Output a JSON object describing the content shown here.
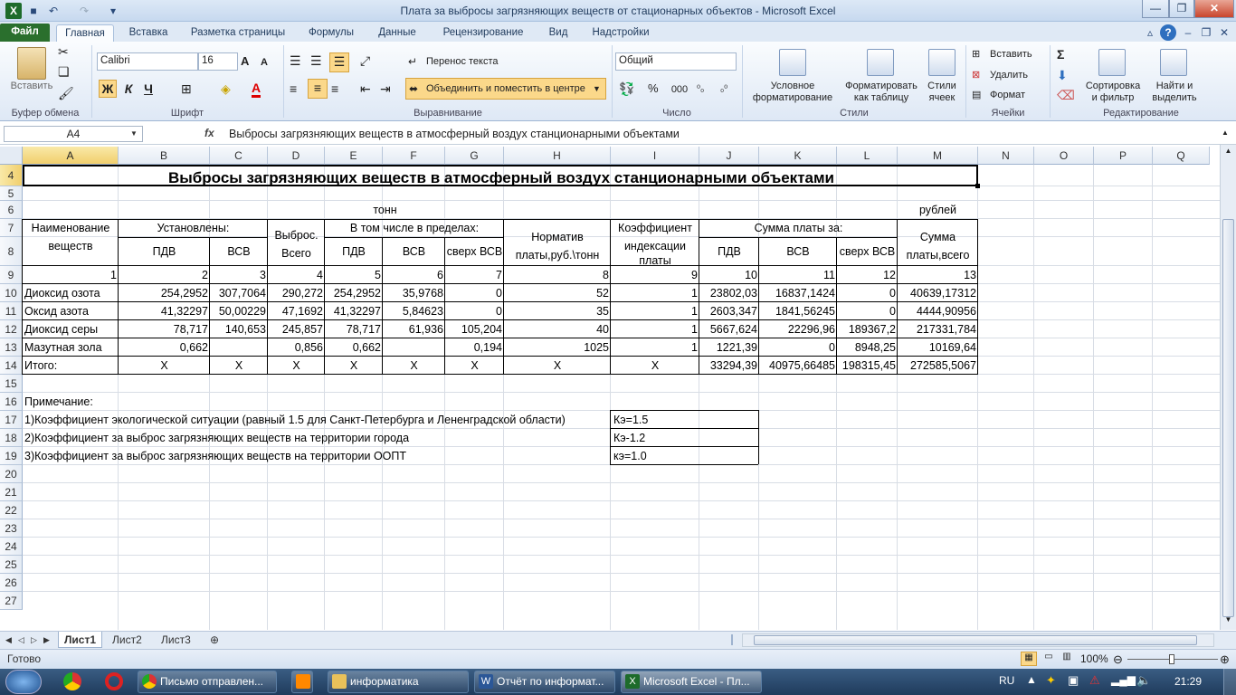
{
  "window": {
    "title": "Плата за выбросы загрязняющих веществ от  стационарных объектов  -  Microsoft Excel"
  },
  "ribbon_tabs": [
    "Файл",
    "Главная",
    "Вставка",
    "Разметка страницы",
    "Формулы",
    "Данные",
    "Рецензирование",
    "Вид",
    "Надстройки"
  ],
  "clipboard": {
    "paste": "Вставить",
    "group": "Буфер обмена"
  },
  "font": {
    "name": "Calibri",
    "size": "16",
    "group": "Шрифт",
    "bold": "Ж",
    "italic": "К",
    "underline": "Ч"
  },
  "alignment": {
    "wrap": "Перенос текста",
    "merge": "Объединить и поместить в центре",
    "group": "Выравнивание"
  },
  "number": {
    "format": "Общий",
    "group": "Число",
    "percent": "%",
    "thousands": "000"
  },
  "styles": {
    "cond1": "Условное",
    "cond2": "форматирование",
    "table1": "Форматировать",
    "table2": "как таблицу",
    "cell1": "Стили",
    "cell2": "ячеек",
    "group": "Стили"
  },
  "cells_grp": {
    "insert": "Вставить",
    "delete": "Удалить",
    "format": "Формат",
    "group": "Ячейки"
  },
  "editing": {
    "sort1": "Сортировка",
    "sort2": "и фильтр",
    "find1": "Найти и",
    "find2": "выделить",
    "group": "Редактирование"
  },
  "formula_bar": {
    "name_box": "A4",
    "fx": "fx",
    "content": "Выбросы загрязняющих веществ в атмосферный воздух станционарными объектами"
  },
  "columns": [
    "A",
    "B",
    "C",
    "D",
    "E",
    "F",
    "G",
    "H",
    "I",
    "J",
    "K",
    "L",
    "M",
    "N",
    "O",
    "P",
    "Q"
  ],
  "rows": [
    "4",
    "5",
    "6",
    "7",
    "8",
    "9",
    "10",
    "11",
    "12",
    "13",
    "14",
    "15",
    "16",
    "17",
    "18",
    "19",
    "20",
    "21",
    "22",
    "23",
    "24",
    "25",
    "26",
    "27"
  ],
  "sheet": {
    "title": "Выбросы загрязняющих веществ в атмосферный воздух станционарными объектами",
    "unit_tons": "тонн",
    "unit_rub": "рублей",
    "h_name1": "Наименование",
    "h_name2": "веществ",
    "h_established": "Установлены:",
    "h_pdv": "ПДВ",
    "h_vsv": "ВСВ",
    "h_emission1": "Выброс.",
    "h_emission2": "Всего",
    "h_within": "В том числе в пределах:",
    "h_over": "сверх ВСВ",
    "h_norm1": "Норматив",
    "h_norm2": "платы,руб.\\тонн",
    "h_coef1": "Коэффициент",
    "h_coef2": "индексации",
    "h_coef3": "платы",
    "h_sum": "Сумма платы за:",
    "h_total1": "Сумма",
    "h_total2": "платы,всего",
    "numbers": [
      "1",
      "2",
      "3",
      "4",
      "5",
      "6",
      "7",
      "8",
      "9",
      "10",
      "11",
      "12",
      "13"
    ],
    "data_rows": [
      [
        "Диоксид озота",
        "254,2952",
        "307,7064",
        "290,272",
        "254,2952",
        "35,9768",
        "0",
        "52",
        "1",
        "23802,03",
        "16837,1424",
        "0",
        "40639,17312"
      ],
      [
        "Оксид азота",
        "41,32297",
        "50,00229",
        "47,1692",
        "41,32297",
        "5,84623",
        "0",
        "35",
        "1",
        "2603,347",
        "1841,56245",
        "0",
        "4444,90956"
      ],
      [
        "Диоксид серы",
        "78,717",
        "140,653",
        "245,857",
        "78,717",
        "61,936",
        "105,204",
        "40",
        "1",
        "5667,624",
        "22296,96",
        "189367,2",
        "217331,784"
      ],
      [
        "Мазутная зола",
        "0,662",
        "",
        "0,856",
        "0,662",
        "",
        "0,194",
        "1025",
        "1",
        "1221,39",
        "0",
        "8948,25",
        "10169,64"
      ],
      [
        "Итого:",
        "X",
        "X",
        "X",
        "X",
        "X",
        "X",
        "X",
        "X",
        "33294,39",
        "40975,66485",
        "198315,45",
        "272585,5067"
      ]
    ],
    "note_title": "Примечание:",
    "notes": [
      {
        "text": "1)Коэффициент экологической ситуации (равный 1.5 для Санкт-Петербурга и Лененградской области)",
        "value": "Кэ=1.5"
      },
      {
        "text": "2)Коэффициент за выброс загрязняющих веществ на территории города",
        "value": "Кэ-1.2"
      },
      {
        "text": "3)Коэффициент за выброс загрязняющих веществ на территории ООПТ",
        "value": "кэ=1.0"
      }
    ]
  },
  "sheet_tabs": [
    "Лист1",
    "Лист2",
    "Лист3"
  ],
  "status": {
    "ready": "Готово",
    "zoom": "100%"
  },
  "taskbar": {
    "items": [
      "Письмо отправлен...",
      "информатика",
      "Отчёт по информат...",
      "Microsoft Excel - Пл..."
    ],
    "lang": "RU",
    "time": "21:29"
  },
  "colors": {
    "file_tab": "#2a6f2d",
    "selection": "#f1cf6d",
    "taskbar": "#1f3b5c"
  }
}
